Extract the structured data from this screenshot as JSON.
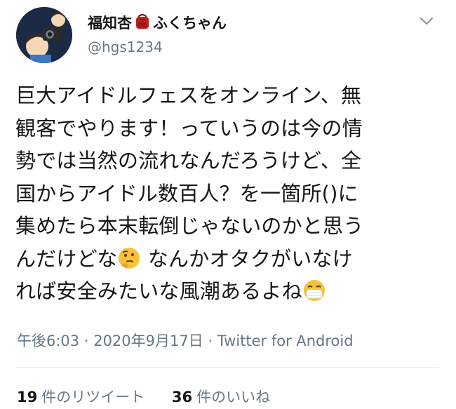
{
  "user": {
    "name_part1": "福知杏",
    "name_part2": "ふくちゃん",
    "handle": "@hgs1234"
  },
  "tweet": {
    "lines": [
      "巨大アイドルフェスをオンライン、無",
      "観客でやります！っていうのは今の情",
      "勢では当然の流れなんだろうけど、全",
      "国からアイドル数百人？を一箇所()に",
      "集めたら本末転倒じゃないのかと思う",
      "んだけどな",
      " なんかオタクがいなけ",
      "れば安全みたいな風潮あるよね"
    ],
    "emojis": {
      "thinking": "thinking-face-emoji",
      "mask": "face-with-medical-mask-emoji",
      "name_deco": "red-backpack-emoji"
    }
  },
  "meta": {
    "time": "午後6:03",
    "sep1": " · ",
    "date": "2020年9月17日",
    "sep2": " · ",
    "source": "Twitter for Android"
  },
  "stats": {
    "retweets_count": "19",
    "retweets_label": "件のリツイート",
    "likes_count": "36",
    "likes_label": "件のいいね"
  }
}
